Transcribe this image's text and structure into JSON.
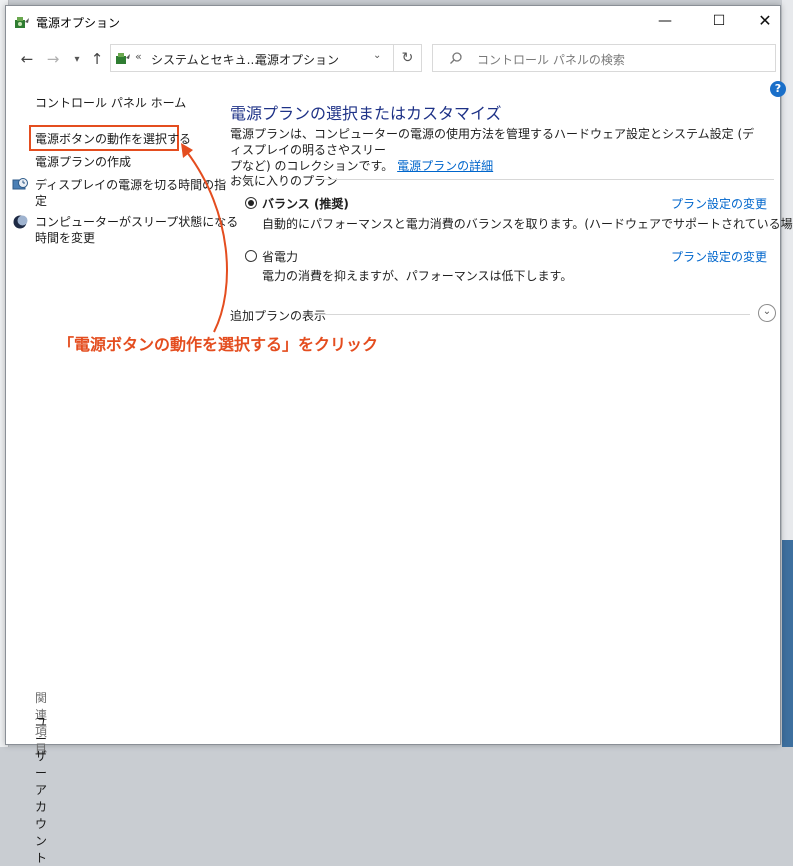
{
  "window": {
    "title": "電源オプション",
    "minimize": "—",
    "maximize": "☐",
    "close": "✕"
  },
  "addressbar": {
    "crumb_prefix": "«",
    "crumb1": "システムとセキュ...",
    "crumb_separator": "›",
    "crumb2": "電源オプション",
    "dropdown": "⌄",
    "refresh": "↻"
  },
  "search": {
    "placeholder": "コントロール パネルの検索"
  },
  "help_label": "?",
  "sidebar": {
    "home": "コントロール パネル ホーム",
    "items": [
      {
        "label": "電源ボタンの動作を選択する"
      },
      {
        "label": "電源プランの作成"
      },
      {
        "label": "ディスプレイの電源を切る時間の指定",
        "line1": "ディスプレイの電源を切る時間の指",
        "line2": "定"
      },
      {
        "label": "コンピューターがスリープ状態になる時間を変更",
        "line1": "コンピューターがスリープ状態になる",
        "line2": "時間を変更"
      }
    ],
    "related_title": "関連項目",
    "related_items": [
      "ユーザー アカウント"
    ]
  },
  "main": {
    "heading": "電源プランの選択またはカスタマイズ",
    "description_line1": "電源プランは、コンピューターの電源の使用方法を管理するハードウェア設定とシステム設定 (ディスプレイの明るさやスリー",
    "description_line2": "プなど) のコレクションです。",
    "description_link": "電源プランの詳細",
    "favorites_label": "お気に入りのプラン",
    "plans": [
      {
        "name": "バランス (推奨)",
        "description": "自動的にパフォーマンスと電力消費のバランスを取ります。(ハードウェアでサポートされている場合)",
        "link": "プラン設定の変更",
        "selected": true
      },
      {
        "name": "省電力",
        "description": "電力の消費を抑えますが、パフォーマンスは低下します。",
        "link": "プラン設定の変更",
        "selected": false
      }
    ],
    "extra_plans_label": "追加プランの表示"
  },
  "annotation": {
    "text": "「電源ボタンの動作を選択する」をクリック",
    "color": "#e44d1f"
  },
  "colors": {
    "heading": "#1e3287",
    "link": "#0066cc",
    "accent": "#e44d1f"
  }
}
